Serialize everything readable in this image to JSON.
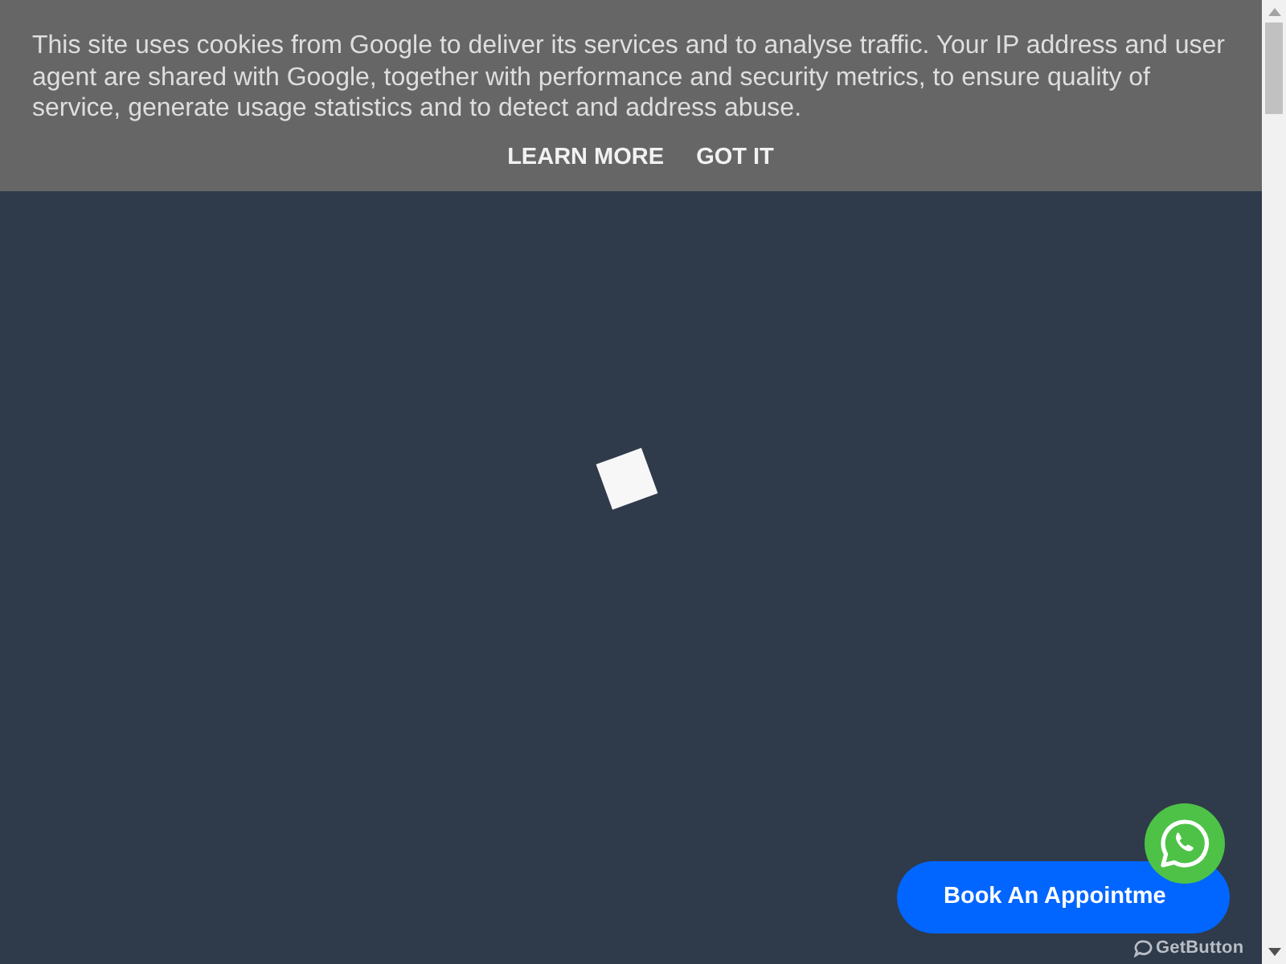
{
  "cookie_banner": {
    "message": "This site uses cookies from Google to deliver its services and to analyse traffic. Your IP address and user agent are shared with Google, together with performance and security metrics, to ensure quality of service, generate usage statistics and to detect and address abuse.",
    "buttons": [
      "LEARN MORE",
      "GOT IT"
    ]
  },
  "book_button": {
    "label": "Book An Appointme"
  },
  "widget_badge": {
    "label": "GetButton"
  }
}
